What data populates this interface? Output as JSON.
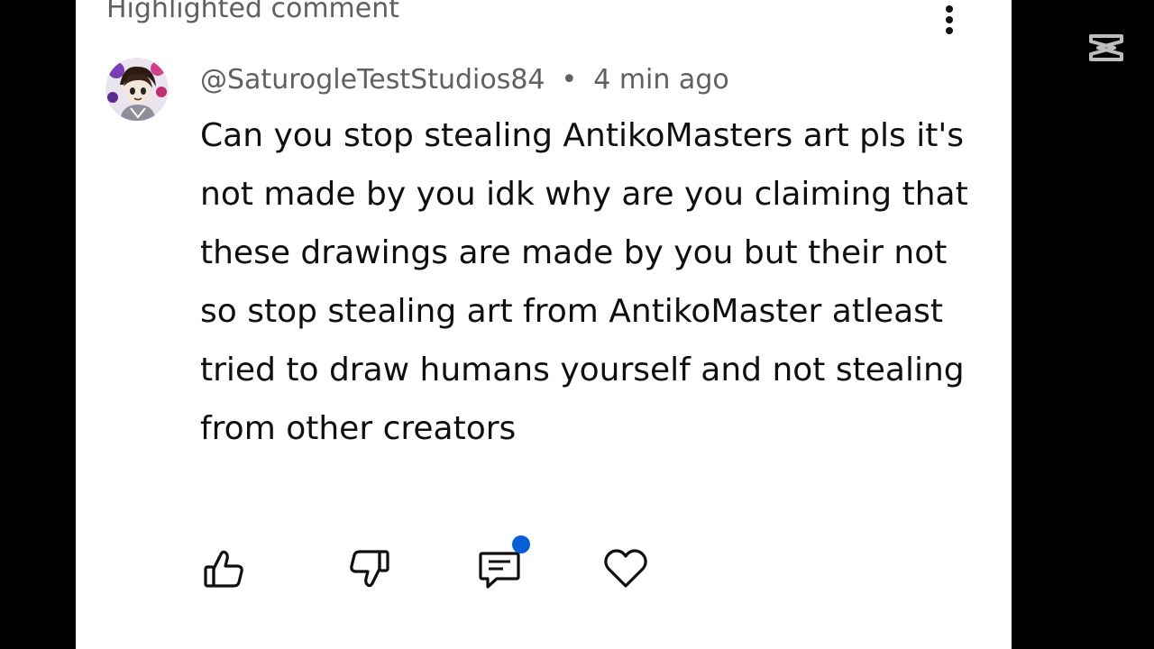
{
  "comment": {
    "section_label": "Highlighted comment",
    "author": "@SaturogleTestStudios84",
    "separator": "•",
    "timestamp": "4 min ago",
    "text": "Can you stop stealing AntikoMasters art pls it's not made by you idk why are you claiming that these drawings are made by you but their not so stop stealing art from AntikoMaster atleast tried to draw humans yourself and not stealing from other creators"
  },
  "icons": {
    "more": "more-vertical-icon",
    "like": "thumbs-up-icon",
    "dislike": "thumbs-down-icon",
    "reply": "comment-icon",
    "heart": "heart-icon",
    "watermark": "capcut-logo-icon"
  },
  "colors": {
    "background": "#000000",
    "panel": "#ffffff",
    "text_primary": "#0f0f0f",
    "text_secondary": "#606060",
    "notification_dot": "#065fd4",
    "watermark": "#bdbdbd"
  }
}
